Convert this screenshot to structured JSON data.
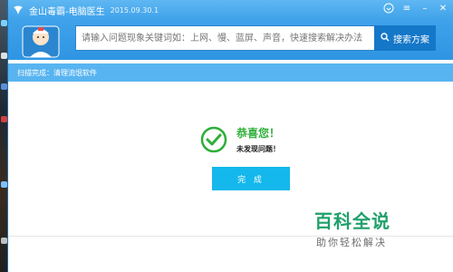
{
  "window": {
    "title": "金山毒霸-电脑医生",
    "version": "2015.09.30.1"
  },
  "search": {
    "placeholder": "请输入问题现象关键词如：上网、慢、蓝屏、声音，快速搜索解决办法",
    "button_label": "搜索方案"
  },
  "status": {
    "text": "扫描完成：清理流氓软件"
  },
  "result": {
    "title": "恭喜您！",
    "message": "未发现问题！",
    "done_label": "完 成"
  },
  "watermark": {
    "main": "百科全说",
    "sub": "助你轻松解决"
  },
  "colors": {
    "titlebar": "#4aaaee",
    "accent": "#14b8ec",
    "success": "#2fae3a",
    "watermark": "#1fa06a"
  }
}
